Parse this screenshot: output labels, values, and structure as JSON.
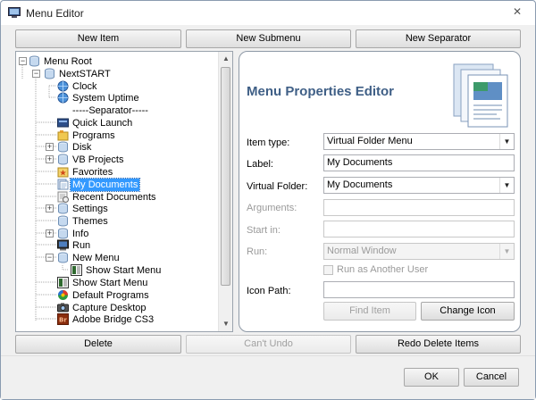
{
  "window": {
    "title": "Menu Editor",
    "close_glyph": "✕",
    "icon": "window-app-icon"
  },
  "toolbar": {
    "new_item": "New Item",
    "new_submenu": "New Submenu",
    "new_separator": "New Separator"
  },
  "tree": {
    "items": [
      {
        "label": "Menu Root",
        "icon": "cylinder-icon"
      },
      {
        "label": "NextSTART",
        "icon": "cylinder-icon"
      },
      {
        "label": "Clock",
        "icon": "globe-icon"
      },
      {
        "label": "System Uptime",
        "icon": "globe-icon"
      },
      {
        "label": "-----Separator-----",
        "icon": ""
      },
      {
        "label": "Quick Launch",
        "icon": "quick-launch-icon"
      },
      {
        "label": "Programs",
        "icon": "programs-icon"
      },
      {
        "label": "Disk",
        "icon": "cylinder-icon"
      },
      {
        "label": "VB Projects",
        "icon": "cylinder-icon"
      },
      {
        "label": "Favorites",
        "icon": "favorites-icon"
      },
      {
        "label": "My Documents",
        "icon": "documents-icon"
      },
      {
        "label": "Recent Documents",
        "icon": "recent-docs-icon"
      },
      {
        "label": "Settings",
        "icon": "cylinder-icon"
      },
      {
        "label": "Themes",
        "icon": "cylinder-icon"
      },
      {
        "label": "Info",
        "icon": "cylinder-icon"
      },
      {
        "label": "Run",
        "icon": "run-icon"
      },
      {
        "label": "New Menu",
        "icon": "cylinder-icon"
      },
      {
        "label": "Show Start Menu",
        "icon": "start-menu-icon"
      },
      {
        "label": "Show Start Menu",
        "icon": "start-menu-icon"
      },
      {
        "label": "Default Programs",
        "icon": "default-programs-icon"
      },
      {
        "label": "Capture Desktop",
        "icon": "camera-icon"
      },
      {
        "label": "Adobe Bridge CS3",
        "icon": "adobe-bridge-icon"
      }
    ],
    "selected": "My Documents"
  },
  "editor": {
    "title": "Menu Properties Editor",
    "item_type": {
      "label": "Item type:",
      "value": "Virtual Folder Menu"
    },
    "label_field": {
      "label": "Label:",
      "value": "My Documents"
    },
    "virtual_folder": {
      "label": "Virtual Folder:",
      "value": "My Documents"
    },
    "arguments": {
      "label": "Arguments:",
      "value": ""
    },
    "start_in": {
      "label": "Start in:",
      "value": ""
    },
    "run": {
      "label": "Run:",
      "value": "Normal Window"
    },
    "run_as_other": {
      "label": "Run as Another User",
      "checked": false
    },
    "icon_path": {
      "label": "Icon Path:",
      "value": ""
    },
    "find_item": "Find Item",
    "change_icon": "Change Icon"
  },
  "actions": {
    "delete": "Delete",
    "cant_undo": "Can't Undo",
    "redo_delete": "Redo Delete Items"
  },
  "footer": {
    "ok": "OK",
    "cancel": "Cancel"
  },
  "colors": {
    "accent_title": "#3f5f86",
    "selection": "#3399ff"
  }
}
